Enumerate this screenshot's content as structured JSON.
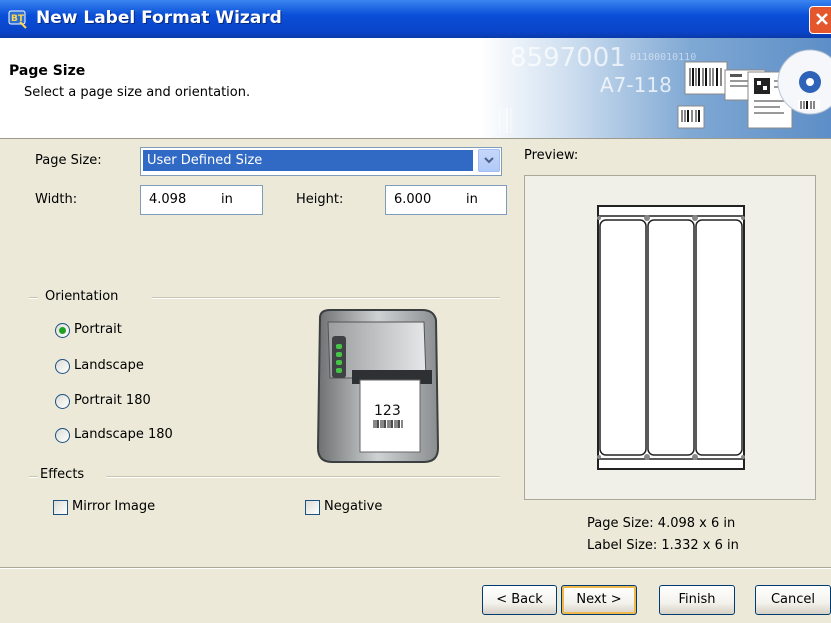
{
  "window": {
    "title": "New Label Format Wizard",
    "icon": "bartender-app-icon"
  },
  "header": {
    "heading": "Page Size",
    "subheading": "Select a page size and orientation.",
    "art_text": {
      "number": "8597001",
      "code": "A7-118",
      "binary": "01100010110"
    }
  },
  "page_size": {
    "label": "Page Size:",
    "value": "User Defined Size"
  },
  "width": {
    "label": "Width:",
    "value": "4.098",
    "unit": "in"
  },
  "height": {
    "label": "Height:",
    "value": "6.000",
    "unit": "in"
  },
  "orientation": {
    "group_label": "Orientation",
    "options": [
      {
        "label": "Portrait",
        "selected": true
      },
      {
        "label": "Landscape",
        "selected": false
      },
      {
        "label": "Portrait 180",
        "selected": false
      },
      {
        "label": "Landscape 180",
        "selected": false
      }
    ]
  },
  "printer_illustration": {
    "paper_text": "123"
  },
  "effects": {
    "group_label": "Effects",
    "mirror_image": {
      "label": "Mirror Image",
      "checked": false
    },
    "negative": {
      "label": "Negative",
      "checked": false
    }
  },
  "preview": {
    "label": "Preview:",
    "page_size_text": "Page Size:  4.098 x 6 in",
    "label_size_text": "Label Size:  1.332 x 6 in"
  },
  "buttons": {
    "back": "< Back",
    "next": "Next >",
    "finish": "Finish",
    "cancel": "Cancel"
  },
  "colors": {
    "titlebar": "#0a4fd8",
    "selection": "#316ac5",
    "dialog_bg": "#ece9d8"
  }
}
